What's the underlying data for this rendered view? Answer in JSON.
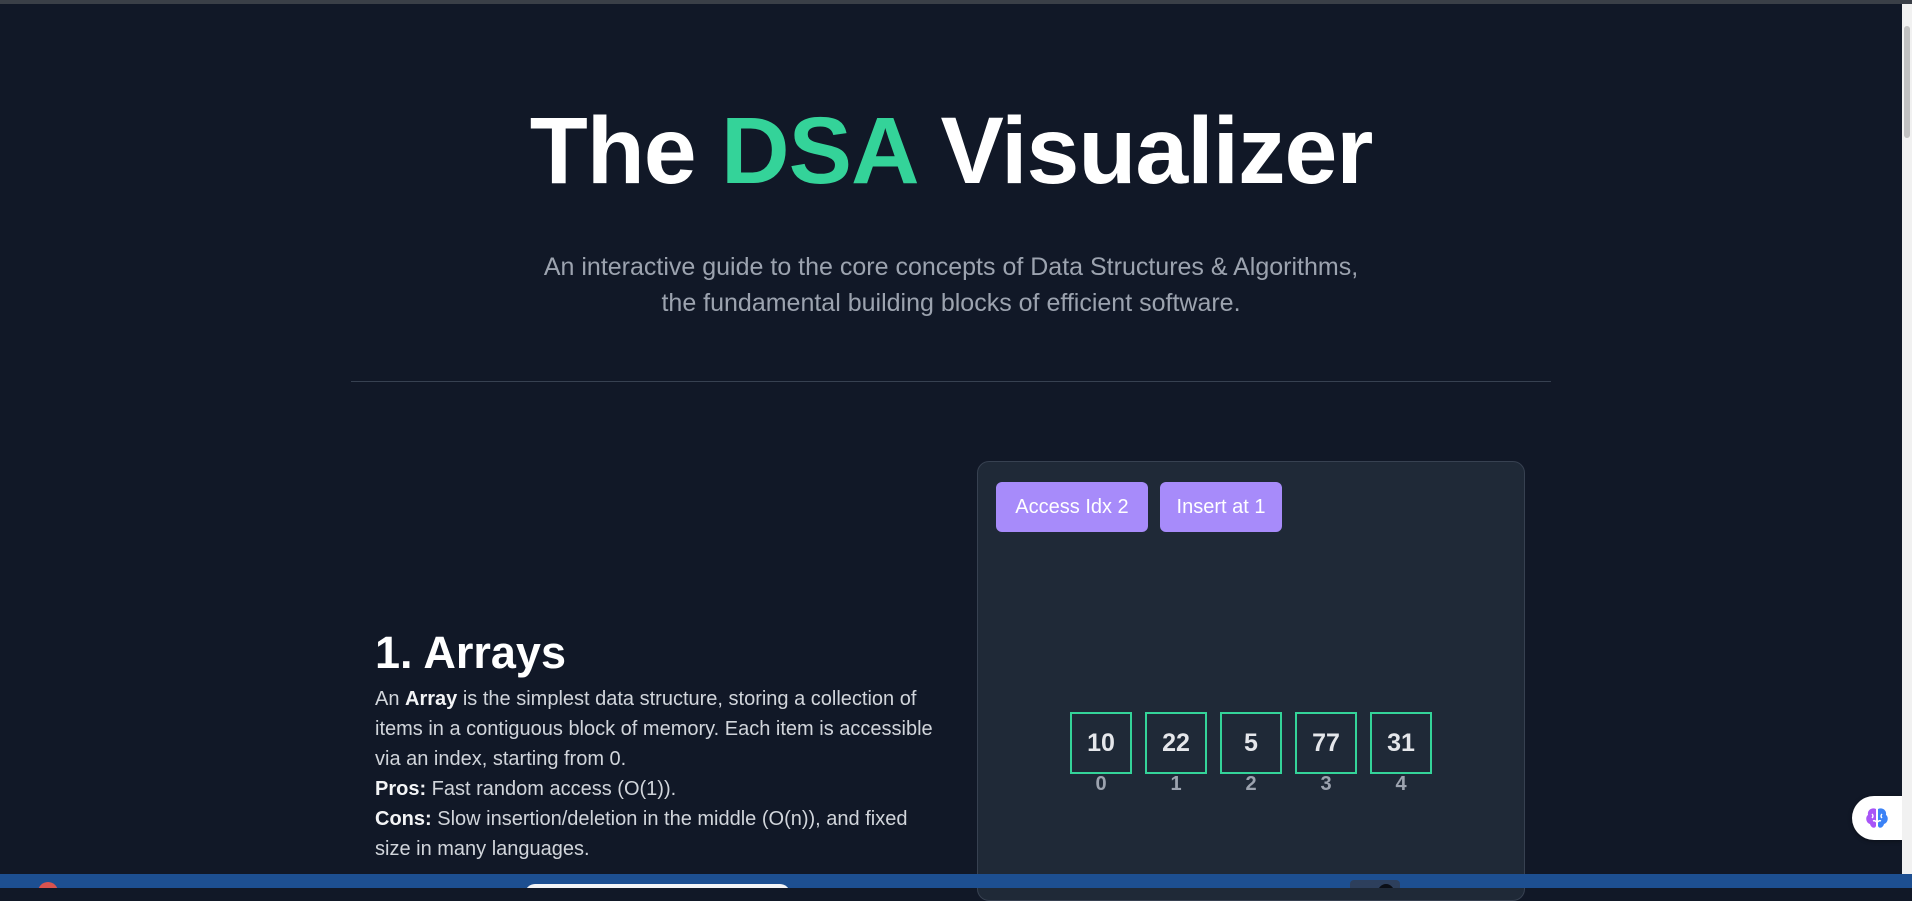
{
  "hero": {
    "title_before": "The ",
    "title_accent": "DSA",
    "title_after": " Visualizer",
    "subtitle_line1": "An interactive guide to the core concepts of Data Structures & Algorithms,",
    "subtitle_line2": "the fundamental building blocks of efficient software."
  },
  "arrays_section": {
    "heading": "1. Arrays",
    "desc_prefix": "An ",
    "desc_term": "Array",
    "desc_rest": " is the simplest data structure, storing a collection of items in a contiguous block of memory. Each item is accessible via an index, starting from 0.",
    "pros_label": "Pros:",
    "pros_text": " Fast random access (O(1)).",
    "cons_label": "Cons:",
    "cons_text": " Slow insertion/deletion in the middle (O(n)), and fixed size in many languages."
  },
  "visualizer": {
    "buttons": {
      "access_label": "Access Idx 2",
      "insert_label": "Insert at 1"
    },
    "array": {
      "values": [
        "10",
        "22",
        "5",
        "77",
        "31"
      ],
      "indices": [
        "0",
        "1",
        "2",
        "3",
        "4"
      ]
    }
  },
  "colors": {
    "background": "#111827",
    "accent_green": "#34d399",
    "button_purple": "#a78bfa",
    "panel": "#1f2937"
  },
  "icons": {
    "side_widget": "brain-icon"
  }
}
